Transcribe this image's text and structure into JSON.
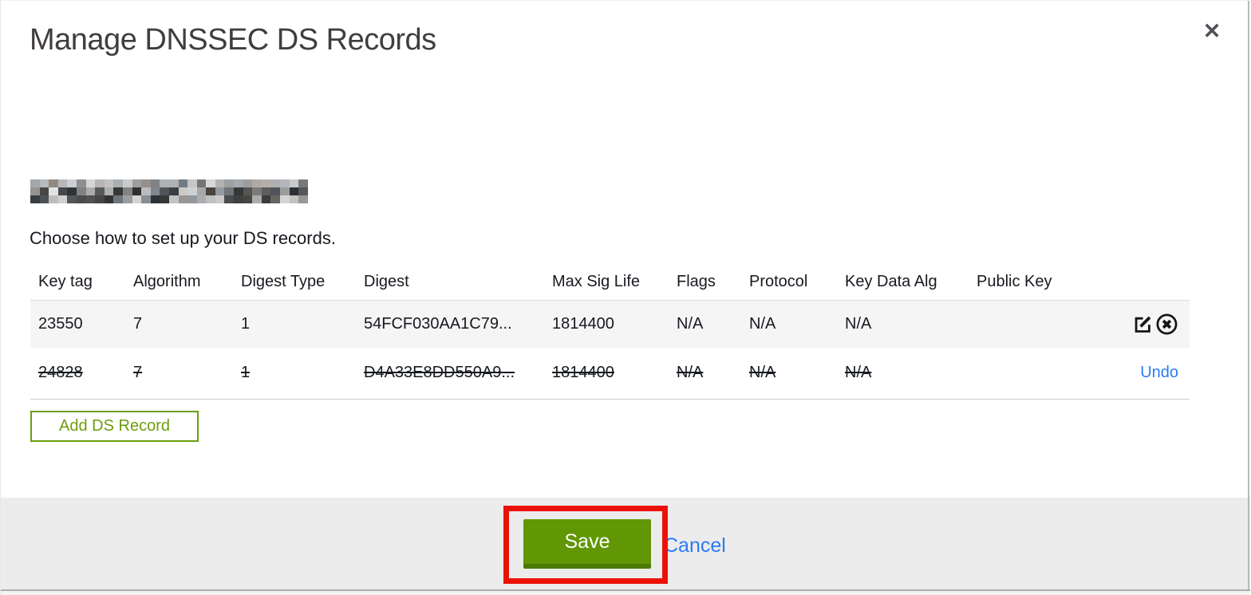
{
  "modal": {
    "title": "Manage DNSSEC DS Records",
    "close_icon": "✕",
    "instruction": "Choose how to set up your DS records."
  },
  "table": {
    "columns": [
      "Key tag",
      "Algorithm",
      "Digest Type",
      "Digest",
      "Max Sig Life",
      "Flags",
      "Protocol",
      "Key Data Alg",
      "Public Key"
    ],
    "rows": [
      {
        "cells": [
          "23550",
          "7",
          "1",
          "54FCF030AA1C79...",
          "1814400",
          "N/A",
          "N/A",
          "N/A",
          ""
        ],
        "deleted": false,
        "actions": [
          "edit",
          "delete"
        ]
      },
      {
        "cells": [
          "24828",
          "7",
          "1",
          "D4A33E8DD550A9...",
          "1814400",
          "N/A",
          "N/A",
          "N/A",
          ""
        ],
        "deleted": true,
        "action_label": "Undo"
      }
    ]
  },
  "buttons": {
    "add_ds_record": "Add DS Record",
    "save": "Save",
    "cancel": "Cancel",
    "undo": "Undo"
  },
  "icons": {
    "edit": "edit-square-pencil",
    "delete": "circle-x",
    "close": "x-mark"
  },
  "colors": {
    "save_green": "#619605",
    "save_green_dark": "#4e7a06",
    "outline_green": "#6b9e0b",
    "link_blue": "#2a7bf6",
    "annotation_red": "#ea1208",
    "row_gray": "#f5f5f5",
    "footer_gray": "#ececec"
  }
}
